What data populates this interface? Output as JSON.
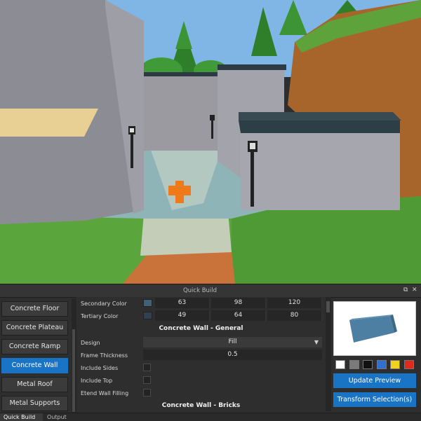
{
  "viewport": {
    "scene": "3D game scene with concrete walls, lamp posts, path and trees"
  },
  "panel": {
    "title": "Quick Build",
    "restore_icon": "restore-window-icon",
    "close_icon": "close-icon",
    "restore_glyph": "⧉",
    "close_glyph": "✕"
  },
  "sidebar": {
    "items": [
      {
        "label": "Concrete Floor",
        "active": false
      },
      {
        "label": "Concrete Plateau",
        "active": false
      },
      {
        "label": "Concrete Ramp",
        "active": false
      },
      {
        "label": "Concrete Wall",
        "active": true
      },
      {
        "label": "Metal Roof",
        "active": false
      },
      {
        "label": "Metal Supports",
        "active": false
      }
    ]
  },
  "properties": {
    "secondary_color": {
      "label": "Secondary Color",
      "r": "63",
      "g": "98",
      "b": "120",
      "swatch": "#3f6278"
    },
    "tertiary_color": {
      "label": "Tertiary Color",
      "r": "49",
      "g": "64",
      "b": "80",
      "swatch": "#314050"
    },
    "general_section": "Concrete Wall - General",
    "design": {
      "label": "Design",
      "value": "Fill"
    },
    "frame_thickness": {
      "label": "Frame Thickness",
      "value": "0.5"
    },
    "include_sides": {
      "label": "Include Sides",
      "checked": false
    },
    "include_top": {
      "label": "Include Top",
      "checked": false
    },
    "etend_wall_filling": {
      "label": "Etend Wall Filling",
      "checked": false
    },
    "bricks_section": "Concrete Wall - Bricks"
  },
  "preview": {
    "palette": [
      {
        "name": "white",
        "color": "#ffffff"
      },
      {
        "name": "gray",
        "color": "#7a7a7a"
      },
      {
        "name": "black",
        "color": "#111111"
      },
      {
        "name": "blue",
        "color": "#2f6fd1"
      },
      {
        "name": "yellow",
        "color": "#f2d21b"
      },
      {
        "name": "red",
        "color": "#e0281c"
      }
    ],
    "update_label": "Update Preview",
    "transform_label": "Transform Selection(s)"
  },
  "bottom_tabs": [
    {
      "label": "Quick Build",
      "active": true
    },
    {
      "label": "Output",
      "active": false
    }
  ]
}
